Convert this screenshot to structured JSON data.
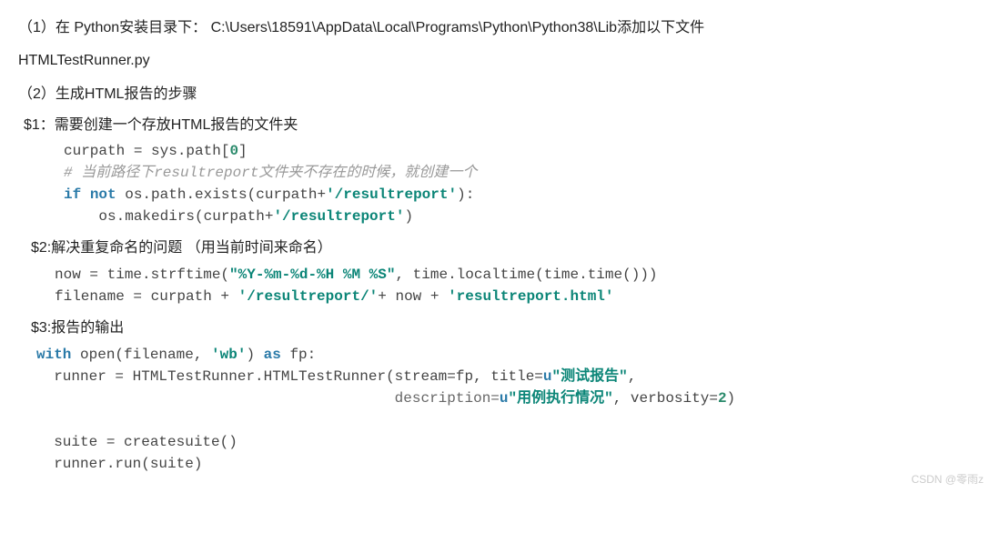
{
  "section1": {
    "intro": "（1）在 Python安装目录下： C:\\Users\\18591\\AppData\\Local\\Programs\\Python\\Python38\\Lib添加以下文件",
    "filename": "HTMLTestRunner.py"
  },
  "section2": {
    "heading": "（2）生成HTML报告的步骤",
    "step1": {
      "label": "$1：需要创建一个存放HTML报告的文件夹",
      "code": {
        "l1_a": "curpath = sys.path[",
        "l1_num": "0",
        "l1_b": "]",
        "l2_comment": "# 当前路径下resultreport文件夹不存在的时候，就创建一个",
        "l3_kw1": "if",
        "l3_kw2": "not",
        "l3_a": " os.path.exists(curpath+",
        "l3_str": "'/resultreport'",
        "l3_b": "):",
        "l4_a": "    os.makedirs(curpath+",
        "l4_str": "'/resultreport'",
        "l4_b": ")"
      }
    },
    "step2": {
      "label": "$2:解决重复命名的问题 （用当前时间来命名）",
      "code": {
        "l1_a": "now = time.strftime(",
        "l1_str": "\"%Y-%m-%d-%H %M %S\"",
        "l1_b": ", time.localtime(time.time()))",
        "l2_a": "filename = curpath + ",
        "l2_str1": "'/resultreport/'",
        "l2_b": "+ now + ",
        "l2_str2": "'resultreport.html'"
      }
    },
    "step3": {
      "label": "$3:报告的输出",
      "code": {
        "l1_kw1": "with",
        "l1_a": " open(filename, ",
        "l1_str": "'wb'",
        "l1_b": ") ",
        "l1_kw2": "as",
        "l1_c": " fp:",
        "l2_a": "  runner = HTMLTestRunner.HTMLTestRunner(stream=fp, title=",
        "l2_kw_u1": "u",
        "l2_str1": "\"测试报告\"",
        "l2_comma": ",",
        "l3_pad": "                                         ",
        "l3_a": "description=",
        "l3_kw_u2": "u",
        "l3_str2": "\"用例执行情况\"",
        "l3_b": ", verbosity=",
        "l3_num": "2",
        "l3_c": ")",
        "l4": "  suite = createsuite()",
        "l5": "  runner.run(suite)"
      }
    }
  },
  "watermark": "CSDN @零雨z"
}
